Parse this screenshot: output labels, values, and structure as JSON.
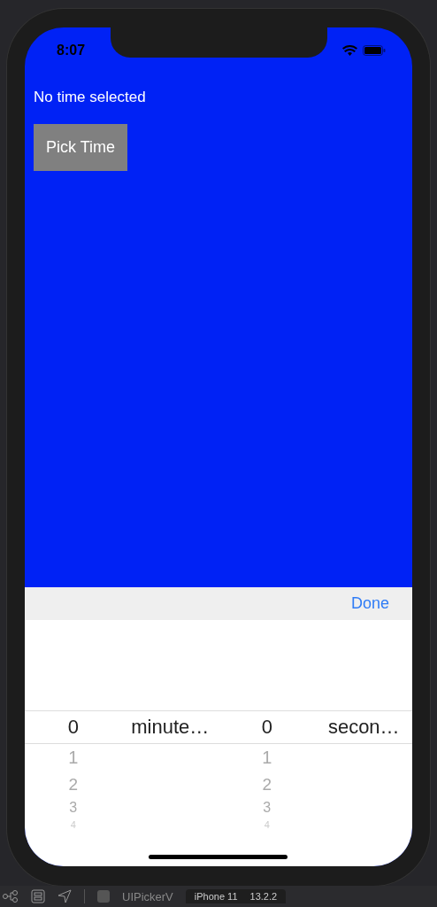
{
  "status_bar": {
    "time": "8:07"
  },
  "label": "No time selected",
  "button": "Pick Time",
  "toolbar": {
    "done": "Done"
  },
  "picker": {
    "components": [
      {
        "unit": "minute…",
        "values": [
          {
            "text": "0",
            "selected": true
          },
          {
            "text": "1",
            "selected": false
          },
          {
            "text": "2",
            "selected": false
          },
          {
            "text": "3",
            "selected": false
          },
          {
            "text": "4",
            "selected": false
          }
        ]
      },
      {
        "unit": "secon…",
        "values": [
          {
            "text": "0",
            "selected": true
          },
          {
            "text": "1",
            "selected": false
          },
          {
            "text": "2",
            "selected": false
          },
          {
            "text": "3",
            "selected": false
          },
          {
            "text": "4",
            "selected": false
          }
        ]
      }
    ]
  },
  "xcode_bar": {
    "scheme": "UIPickerV",
    "device": "iPhone 11",
    "version": "13.2.2"
  }
}
